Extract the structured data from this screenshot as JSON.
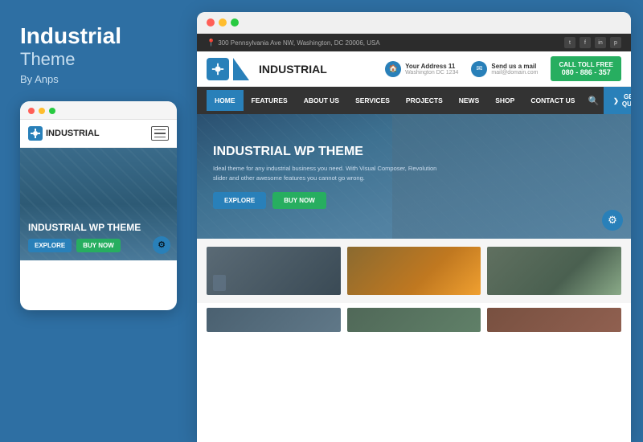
{
  "left": {
    "title": "Industrial",
    "subtitle": "Theme",
    "author": "By Anps",
    "mobile": {
      "logo_text": "INDUSTRIAL",
      "hero_title": "INDUSTRIAL WP THEME",
      "btn_explore": "EXPLORE",
      "btn_buynow": "BUY NOW"
    }
  },
  "right": {
    "browser": {},
    "topbar": {
      "address": "300 Pennsylvania Ave NW, Washington, DC 20006, USA"
    },
    "header": {
      "logo_text": "INDUSTRIAL",
      "contact1_label": "Your Address 11",
      "contact1_sublabel": "Washington DC 1234",
      "contact2_label": "Send us a mail",
      "contact2_sublabel": "mail@domain.com",
      "cta_label": "CALL TOLL FREE",
      "cta_phone": "080 - 886 - 357"
    },
    "nav": {
      "items": [
        "HOME",
        "FEATURES",
        "ABOUT US",
        "SERVICES",
        "PROJECTS",
        "NEWS",
        "SHOP",
        "CONTACT US"
      ],
      "quote_btn": "GET A QUOTE"
    },
    "hero": {
      "title": "INDUSTRIAL WP THEME",
      "description": "Ideal theme for any industrial business you need. With Visual Composer, Revolution slider and other awesome features you cannot go wrong.",
      "btn_explore": "EXPLORE",
      "btn_buynow": "BUY NOW"
    }
  },
  "icons": {
    "gear": "⚙",
    "home": "🏠",
    "mail": "✉",
    "map_pin": "📍",
    "search": "🔍",
    "arrow_right": "❯",
    "hamburger": "☰",
    "twitter": "t",
    "facebook": "f",
    "linkedin": "in",
    "pinterest": "p"
  }
}
